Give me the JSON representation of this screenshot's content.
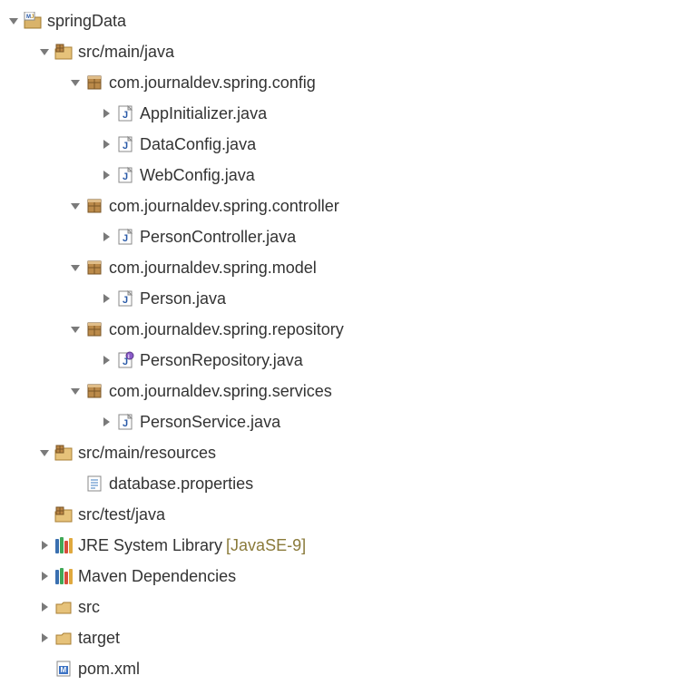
{
  "tree": {
    "root": {
      "label": "springData",
      "children": {
        "src_main_java": {
          "label": "src/main/java",
          "packages": {
            "config": {
              "label": "com.journaldev.spring.config",
              "files": [
                "AppInitializer.java",
                "DataConfig.java",
                "WebConfig.java"
              ]
            },
            "controller": {
              "label": "com.journaldev.spring.controller",
              "files": [
                "PersonController.java"
              ]
            },
            "model": {
              "label": "com.journaldev.spring.model",
              "files": [
                "Person.java"
              ]
            },
            "repository": {
              "label": "com.journaldev.spring.repository",
              "files": [
                "PersonRepository.java"
              ]
            },
            "services": {
              "label": "com.journaldev.spring.services",
              "files": [
                "PersonService.java"
              ]
            }
          }
        },
        "src_main_resources": {
          "label": "src/main/resources",
          "files": [
            "database.properties"
          ]
        },
        "src_test_java": {
          "label": "src/test/java"
        },
        "jre": {
          "label": "JRE System Library",
          "deco": "[JavaSE-9]"
        },
        "maven_deps": {
          "label": "Maven Dependencies"
        },
        "src": {
          "label": "src"
        },
        "target": {
          "label": "target"
        },
        "pom": {
          "label": "pom.xml"
        }
      }
    }
  }
}
